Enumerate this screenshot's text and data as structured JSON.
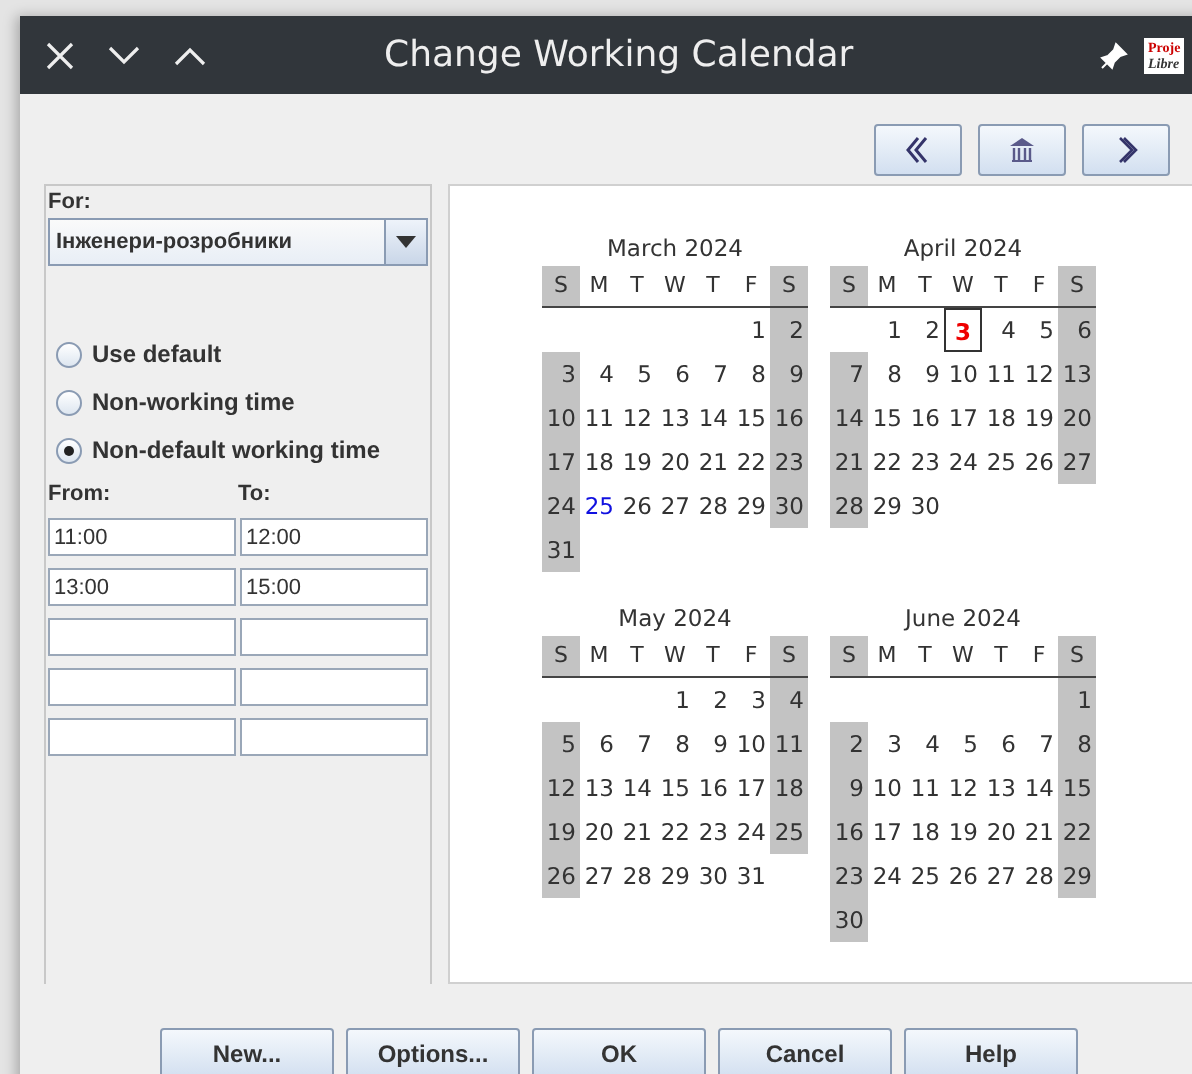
{
  "window": {
    "title": "Change Working Calendar",
    "logo": [
      "Proje",
      "Libre"
    ]
  },
  "for": {
    "label": "For:",
    "value": "Інженери-розробники"
  },
  "options": [
    {
      "label": "Use default",
      "selected": false
    },
    {
      "label": "Non-working time",
      "selected": false
    },
    {
      "label": "Non-default working time",
      "selected": true
    }
  ],
  "hours": {
    "from_label": "From:",
    "to_label": "To:",
    "rows": [
      {
        "from": "11:00",
        "to": "12:00"
      },
      {
        "from": "13:00",
        "to": "15:00"
      },
      {},
      {},
      {}
    ]
  },
  "months": [
    {
      "title": "March 2024",
      "weekdays": [
        "S",
        "M",
        "T",
        "W",
        "T",
        "F",
        "S"
      ],
      "weeks": [
        {
          "kind": "first",
          "days": [
            "1",
            "2"
          ]
        },
        {
          "kind": "week",
          "days": [
            "3",
            "4",
            "5",
            "6",
            "7",
            "8",
            "9"
          ]
        },
        {
          "kind": "week",
          "days": [
            "10",
            "11",
            "12",
            "13",
            "14",
            "15",
            "16"
          ]
        },
        {
          "kind": "week",
          "days": [
            "17",
            "18",
            "19",
            "20",
            "21",
            "22",
            "23"
          ]
        },
        {
          "kind": "week",
          "days": [
            "24",
            {
              "text": "25",
              "kind": "modified"
            },
            "26",
            "27",
            "28",
            "29",
            "30"
          ]
        },
        {
          "kind": "week",
          "days": [
            "31"
          ]
        }
      ]
    },
    {
      "title": "April 2024",
      "weekdays": [
        "S",
        "M",
        "T",
        "W",
        "T",
        "F",
        "S"
      ],
      "weeks": [
        {
          "kind": "first",
          "days": [
            "1",
            "2",
            {
              "text": "3",
              "kind": "selected"
            },
            "4",
            "5",
            "6"
          ]
        },
        {
          "kind": "week",
          "days": [
            "7",
            "8",
            "9",
            "10",
            "11",
            "12",
            "13"
          ]
        },
        {
          "kind": "week",
          "days": [
            "14",
            "15",
            "16",
            "17",
            "18",
            "19",
            "20"
          ]
        },
        {
          "kind": "week",
          "days": [
            "21",
            "22",
            "23",
            "24",
            "25",
            "26",
            "27"
          ]
        },
        {
          "kind": "week",
          "days": [
            "28",
            "29",
            "30"
          ]
        }
      ]
    },
    {
      "title": "May 2024",
      "weekdays": [
        "S",
        "M",
        "T",
        "W",
        "T",
        "F",
        "S"
      ],
      "weeks": [
        {
          "kind": "first",
          "days": [
            "1",
            "2",
            "3",
            "4"
          ]
        },
        {
          "kind": "week",
          "days": [
            "5",
            "6",
            "7",
            "8",
            "9",
            "10",
            "11"
          ]
        },
        {
          "kind": "week",
          "days": [
            "12",
            "13",
            "14",
            "15",
            "16",
            "17",
            "18"
          ]
        },
        {
          "kind": "week",
          "days": [
            "19",
            "20",
            "21",
            "22",
            "23",
            "24",
            "25"
          ]
        },
        {
          "kind": "week",
          "days": [
            "26",
            "27",
            "28",
            "29",
            "30",
            "31"
          ]
        }
      ]
    },
    {
      "title": "June 2024",
      "weekdays": [
        "S",
        "M",
        "T",
        "W",
        "T",
        "F",
        "S"
      ],
      "weeks": [
        {
          "kind": "first",
          "days": [
            "1"
          ]
        },
        {
          "kind": "week",
          "days": [
            "2",
            "3",
            "4",
            "5",
            "6",
            "7",
            "8"
          ]
        },
        {
          "kind": "week",
          "days": [
            "9",
            "10",
            "11",
            "12",
            "13",
            "14",
            "15"
          ]
        },
        {
          "kind": "week",
          "days": [
            "16",
            "17",
            "18",
            "19",
            "20",
            "21",
            "22"
          ]
        },
        {
          "kind": "week",
          "days": [
            "23",
            "24",
            "25",
            "26",
            "27",
            "28",
            "29"
          ]
        },
        {
          "kind": "week",
          "days": [
            "30"
          ]
        }
      ]
    }
  ],
  "buttons": [
    "New...",
    "Options...",
    "OK",
    "Cancel",
    "Help"
  ]
}
